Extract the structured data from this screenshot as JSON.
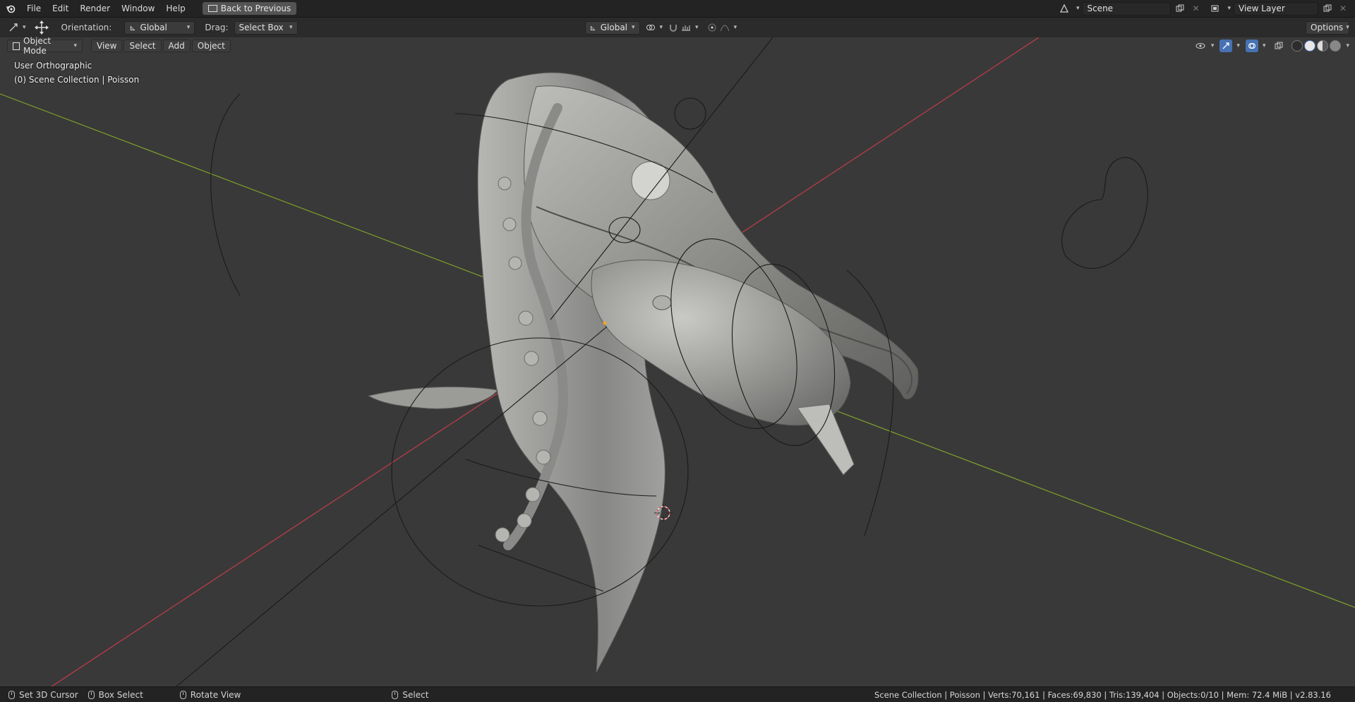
{
  "topbar": {
    "menus": [
      "File",
      "Edit",
      "Render",
      "Window",
      "Help"
    ],
    "back_button": "Back to Previous",
    "scene_value": "Scene",
    "view_layer_value": "View Layer"
  },
  "toolbar": {
    "orientation_label": "Orientation:",
    "orientation_value": "Global",
    "drag_label": "Drag:",
    "drag_value": "Select Box",
    "transform_orientation_value": "Global",
    "options_label": "Options"
  },
  "header": {
    "mode_value": "Object Mode",
    "menus": [
      "View",
      "Select",
      "Add",
      "Object"
    ]
  },
  "viewport": {
    "view_name": "User Orthographic",
    "collection_info": "(0) Scene Collection | Poisson"
  },
  "status": {
    "items": [
      {
        "label": "Set 3D Cursor"
      },
      {
        "label": "Box Select"
      },
      {
        "label": "Rotate View"
      },
      {
        "label": "Select"
      }
    ],
    "stats": "Scene Collection | Poisson | Verts:70,161 | Faces:69,830 | Tris:139,404 | Objects:0/10 | Mem: 72.4 MiB | v2.83.16"
  },
  "colors": {
    "x_axis": "#c43c4a",
    "y_axis": "#7ea02a",
    "viewport_bg": "#393939",
    "model": "#9a9a98",
    "active_blue": "#4772b3"
  },
  "icons": {
    "app_logo": "blender-logo-icon",
    "cursor_tool": "move-icon",
    "scene_icon": "scene-icon",
    "view_layer_icon": "view-layer-icon"
  }
}
